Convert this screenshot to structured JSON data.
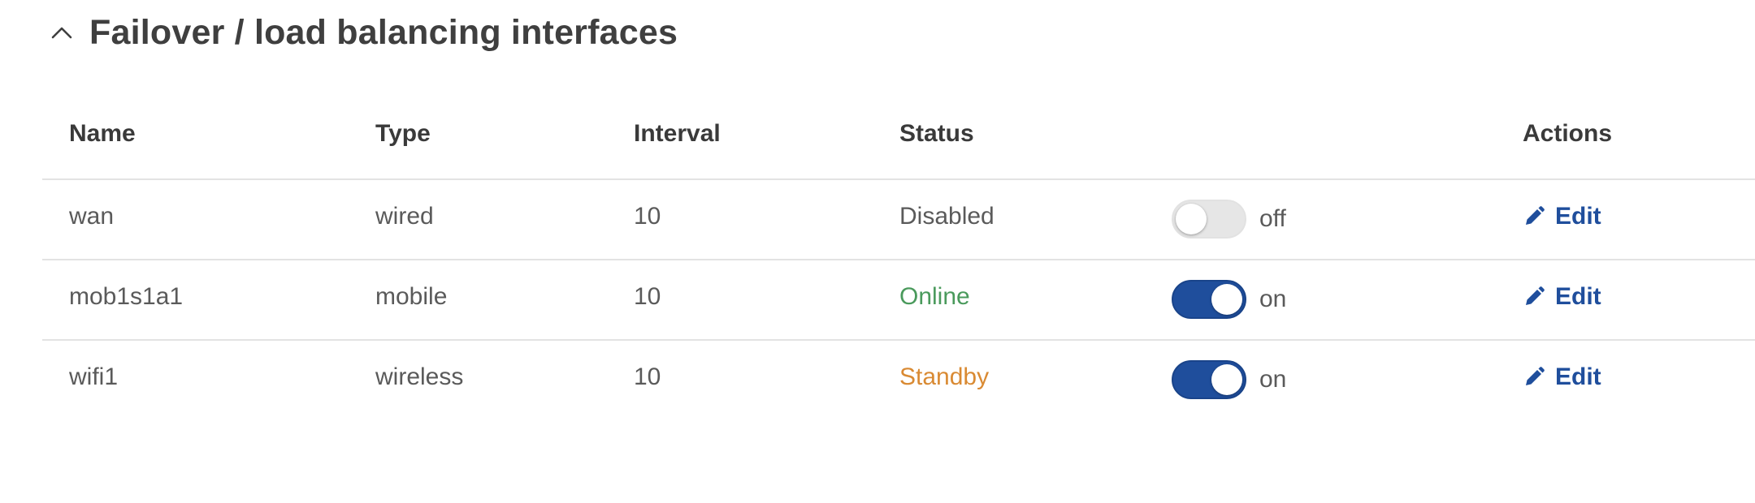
{
  "section": {
    "title": "Failover / load balancing interfaces",
    "collapse_icon": "chevron-up-icon"
  },
  "table": {
    "headers": {
      "name": "Name",
      "type": "Type",
      "interval": "Interval",
      "status": "Status",
      "actions": "Actions"
    },
    "rows": [
      {
        "name": "wan",
        "type": "wired",
        "interval": "10",
        "status": "Disabled",
        "status_color": "#5a5a5a",
        "toggle_state": "off",
        "toggle_label": "off",
        "action_label": "Edit",
        "action_icon": "pencil-icon"
      },
      {
        "name": "mob1s1a1",
        "type": "mobile",
        "interval": "10",
        "status": "Online",
        "status_color": "#4a9a5c",
        "toggle_state": "on",
        "toggle_label": "on",
        "action_label": "Edit",
        "action_icon": "pencil-icon"
      },
      {
        "name": "wifi1",
        "type": "wireless",
        "interval": "10",
        "status": "Standby",
        "status_color": "#d98a33",
        "toggle_state": "on",
        "toggle_label": "on",
        "action_label": "Edit",
        "action_icon": "pencil-icon"
      }
    ]
  },
  "colors": {
    "accent": "#1f4e9c",
    "online": "#4a9a5c",
    "standby": "#d98a33",
    "divider": "#e3e3e3"
  }
}
